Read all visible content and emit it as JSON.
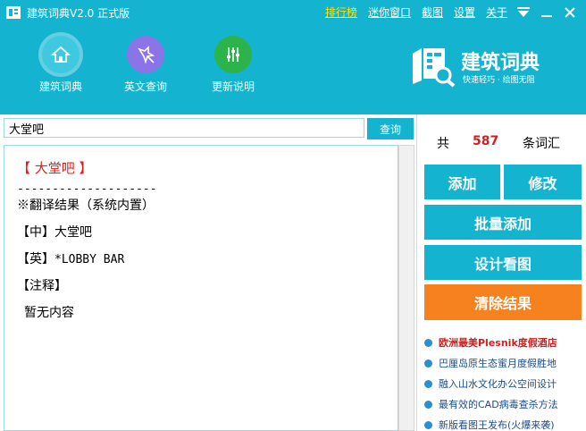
{
  "titlebar": {
    "title": "建筑词典V2.0 正式版",
    "links": {
      "rank": "排行榜",
      "mini": "迷你窗口",
      "screenshot": "截图",
      "settings": "设置",
      "about": "关于"
    }
  },
  "toolbar": {
    "items": [
      {
        "label": "建筑词典",
        "icon": "home-icon"
      },
      {
        "label": "英文查询",
        "icon": "magic-wand-icon"
      },
      {
        "label": "更新说明",
        "icon": "sliders-icon"
      }
    ],
    "brand": {
      "title": "建筑词典",
      "subtitle": "快速轻巧 · 绘图无阻"
    }
  },
  "search": {
    "value": "大堂吧",
    "button": "查询"
  },
  "result": {
    "title": "【 大堂吧 】",
    "separator": "--------------------",
    "heading": "※翻译结果（系统内置）",
    "zh": "【中】大堂吧",
    "en_prefix": "【英】",
    "en_value": "*LOBBY BAR",
    "note": "【注释】",
    "note_value": "暂无内容"
  },
  "stats": {
    "prefix": "共",
    "count": "587",
    "unit": "条词汇"
  },
  "actions": {
    "add": "添加",
    "edit": "修改",
    "batch_add": "批量添加",
    "design": "设计看图",
    "clear": "清除结果"
  },
  "news": [
    {
      "text": "欧洲最美Plesnik度假酒店",
      "hot": true
    },
    {
      "text": "巴厘岛原生态蜜月度假胜地",
      "hot": false
    },
    {
      "text": "融入山水文化办公空间设计",
      "hot": false
    },
    {
      "text": "最有效的CAD病毒查杀方法",
      "hot": false
    },
    {
      "text": "新版看图王发布(火爆来袭)",
      "hot": false
    }
  ],
  "colors": {
    "primary": "#14b4d0",
    "accent_orange": "#f5821f",
    "count_red": "#d21e1e",
    "rank_yellow": "#ffe600"
  }
}
